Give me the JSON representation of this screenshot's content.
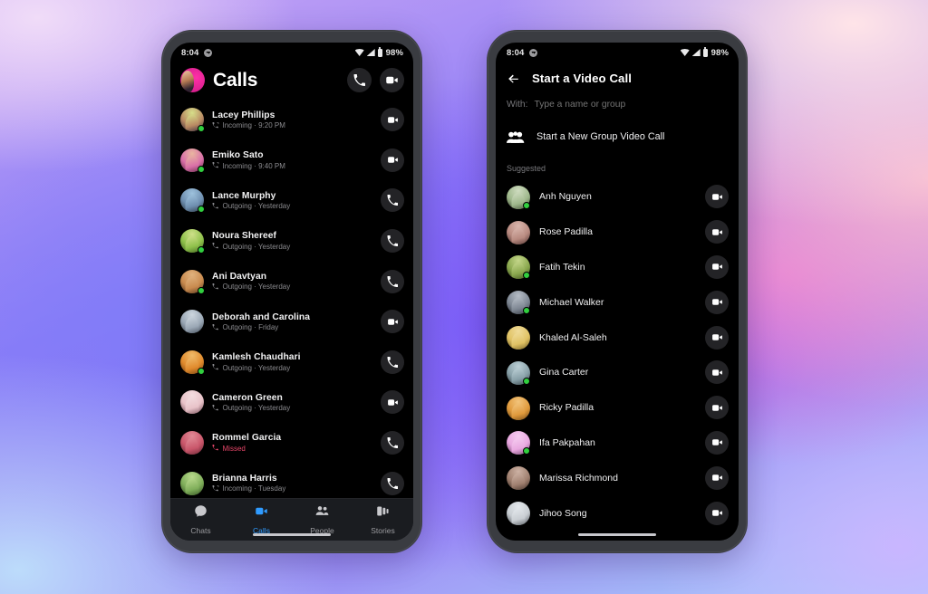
{
  "background": {
    "gradient_colors": [
      "#f0dcf8",
      "#8f7ef7",
      "#7b4ff8",
      "#e06fd6",
      "#f6b9cf",
      "#ffe4e8",
      "#bcdcfb"
    ]
  },
  "theme": {
    "accent": "#2f9bff",
    "online": "#31cf3f",
    "missed": "#e8476a",
    "screen_bg": "#000000",
    "pill_bg": "#232326"
  },
  "phone_left": {
    "status_bar": {
      "time": "8:04",
      "app_icon": "messenger-icon",
      "wifi_icon": "wifi-icon",
      "signal_icon": "signal-icon",
      "battery_icon": "battery-icon",
      "battery": "98%"
    },
    "header": {
      "avatar": "user-avatar",
      "title": "Calls",
      "audio_call_icon": "phone-icon",
      "video_call_icon": "video-camera-icon"
    },
    "calls": [
      {
        "name": "Lacey Phillips",
        "direction": "Incoming",
        "time": "9:20 PM",
        "status": "Incoming · 9:20 PM",
        "missed": false,
        "online": true,
        "action": "video",
        "av1": "#b98a63",
        "av2": "#2c2438",
        "ring": "#d7e08a"
      },
      {
        "name": "Emiko Sato",
        "direction": "Incoming",
        "time": "9:40 PM",
        "status": "Incoming · 9:40 PM",
        "missed": false,
        "online": true,
        "action": "video",
        "av1": "#d96fa8",
        "av2": "#5a2340",
        "ring": "#e9b7a0"
      },
      {
        "name": "Lance Murphy",
        "direction": "Outgoing",
        "time": "Yesterday",
        "status": "Outgoing · Yesterday",
        "missed": false,
        "online": true,
        "action": "phone",
        "av1": "#6f8fb0",
        "av2": "#26313d",
        "ring": "#9ec2dd"
      },
      {
        "name": "Noura Shereef",
        "direction": "Outgoing",
        "time": "Yesterday",
        "status": "Outgoing · Yesterday",
        "missed": false,
        "online": true,
        "action": "phone",
        "av1": "#8ec04a",
        "av2": "#3a5a1e",
        "ring": "#cfe08a"
      },
      {
        "name": "Ani Davtyan",
        "direction": "Outgoing",
        "time": "Yesterday",
        "status": "Outgoing · Yesterday",
        "missed": false,
        "online": true,
        "action": "phone",
        "av1": "#c88a4e",
        "av2": "#4a2d18",
        "ring": "#e0b27e"
      },
      {
        "name": "Deborah and Carolina",
        "direction": "Outgoing",
        "time": "Friday",
        "status": "Outgoing · Friday",
        "missed": false,
        "online": false,
        "action": "video",
        "av1": "#9aa7b5",
        "av2": "#3b4450",
        "ring": "#cdd6de"
      },
      {
        "name": "Kamlesh Chaudhari",
        "direction": "Outgoing",
        "time": "Yesterday",
        "status": "Outgoing · Yesterday",
        "missed": false,
        "online": true,
        "action": "phone",
        "av1": "#e08a2c",
        "av2": "#6a3a10",
        "ring": "#f0bb6a"
      },
      {
        "name": "Cameron Green",
        "direction": "Outgoing",
        "time": "Yesterday",
        "status": "Outgoing · Yesterday",
        "missed": false,
        "online": false,
        "action": "video",
        "av1": "#e8c2c8",
        "av2": "#6b4550",
        "ring": "#f3dde0"
      },
      {
        "name": "Rommel Garcia",
        "direction": "Missed",
        "time": "",
        "status": "Missed",
        "missed": true,
        "online": false,
        "action": "phone",
        "av1": "#c9566a",
        "av2": "#5e2330",
        "ring": "#e08a96"
      },
      {
        "name": "Brianna Harris",
        "direction": "Incoming",
        "time": "Tuesday",
        "status": "Incoming · Tuesday",
        "missed": false,
        "online": false,
        "action": "phone",
        "av1": "#7fae5a",
        "av2": "#2e4a1e",
        "ring": "#b9d98c"
      }
    ],
    "bottom_nav": [
      {
        "label": "Chats",
        "icon": "chat-bubble-icon",
        "active": false
      },
      {
        "label": "Calls",
        "icon": "video-camera-icon",
        "active": true
      },
      {
        "label": "People",
        "icon": "people-icon",
        "active": false
      },
      {
        "label": "Stories",
        "icon": "stories-icon",
        "active": false
      }
    ]
  },
  "phone_right": {
    "status_bar": {
      "time": "8:04",
      "app_icon": "messenger-icon",
      "wifi_icon": "wifi-icon",
      "signal_icon": "signal-icon",
      "battery_icon": "battery-icon",
      "battery": "98%"
    },
    "header": {
      "back_icon": "back-arrow-icon",
      "title": "Start a Video Call"
    },
    "with_field": {
      "label": "With:",
      "value": "",
      "placeholder": "Type a name or group"
    },
    "group_call": {
      "icon": "group-people-icon",
      "label": "Start a New Group Video Call"
    },
    "suggested_label": "Suggested",
    "suggested": [
      {
        "name": "Anh Nguyen",
        "online": true,
        "av1": "#9fb88c",
        "av2": "#3d4a33",
        "ring": "#cfdcc0"
      },
      {
        "name": "Rose Padilla",
        "online": false,
        "av1": "#b88a80",
        "av2": "#4a2f2c",
        "ring": "#d9b6ad"
      },
      {
        "name": "Fatih Tekin",
        "online": true,
        "av1": "#8aa84e",
        "av2": "#3c4a1d",
        "ring": "#c4d68a"
      },
      {
        "name": "Michael Walker",
        "online": true,
        "av1": "#7e8793",
        "av2": "#2c3038",
        "ring": "#b6bdc6"
      },
      {
        "name": "Khaled Al-Saleh",
        "online": false,
        "av1": "#e0c264",
        "av2": "#6d5a20",
        "ring": "#f0dc9a"
      },
      {
        "name": "Gina Carter",
        "online": true,
        "av1": "#88a0a8",
        "av2": "#2f3b40",
        "ring": "#bcd0d6"
      },
      {
        "name": "Ricky Padilla",
        "online": false,
        "av1": "#e09a3c",
        "av2": "#6a4414",
        "ring": "#f2c47c"
      },
      {
        "name": "Ifa Pakpahan",
        "online": true,
        "av1": "#e9a8e0",
        "av2": "#6a3f66",
        "ring": "#f5cdf0"
      },
      {
        "name": "Marissa Richmond",
        "online": false,
        "av1": "#a08070",
        "av2": "#3c2c24",
        "ring": "#cdb2a4"
      },
      {
        "name": "Jihoo Song",
        "online": false,
        "av1": "#c8cdd2",
        "av2": "#4a4f55",
        "ring": "#e4e8ec"
      }
    ]
  }
}
